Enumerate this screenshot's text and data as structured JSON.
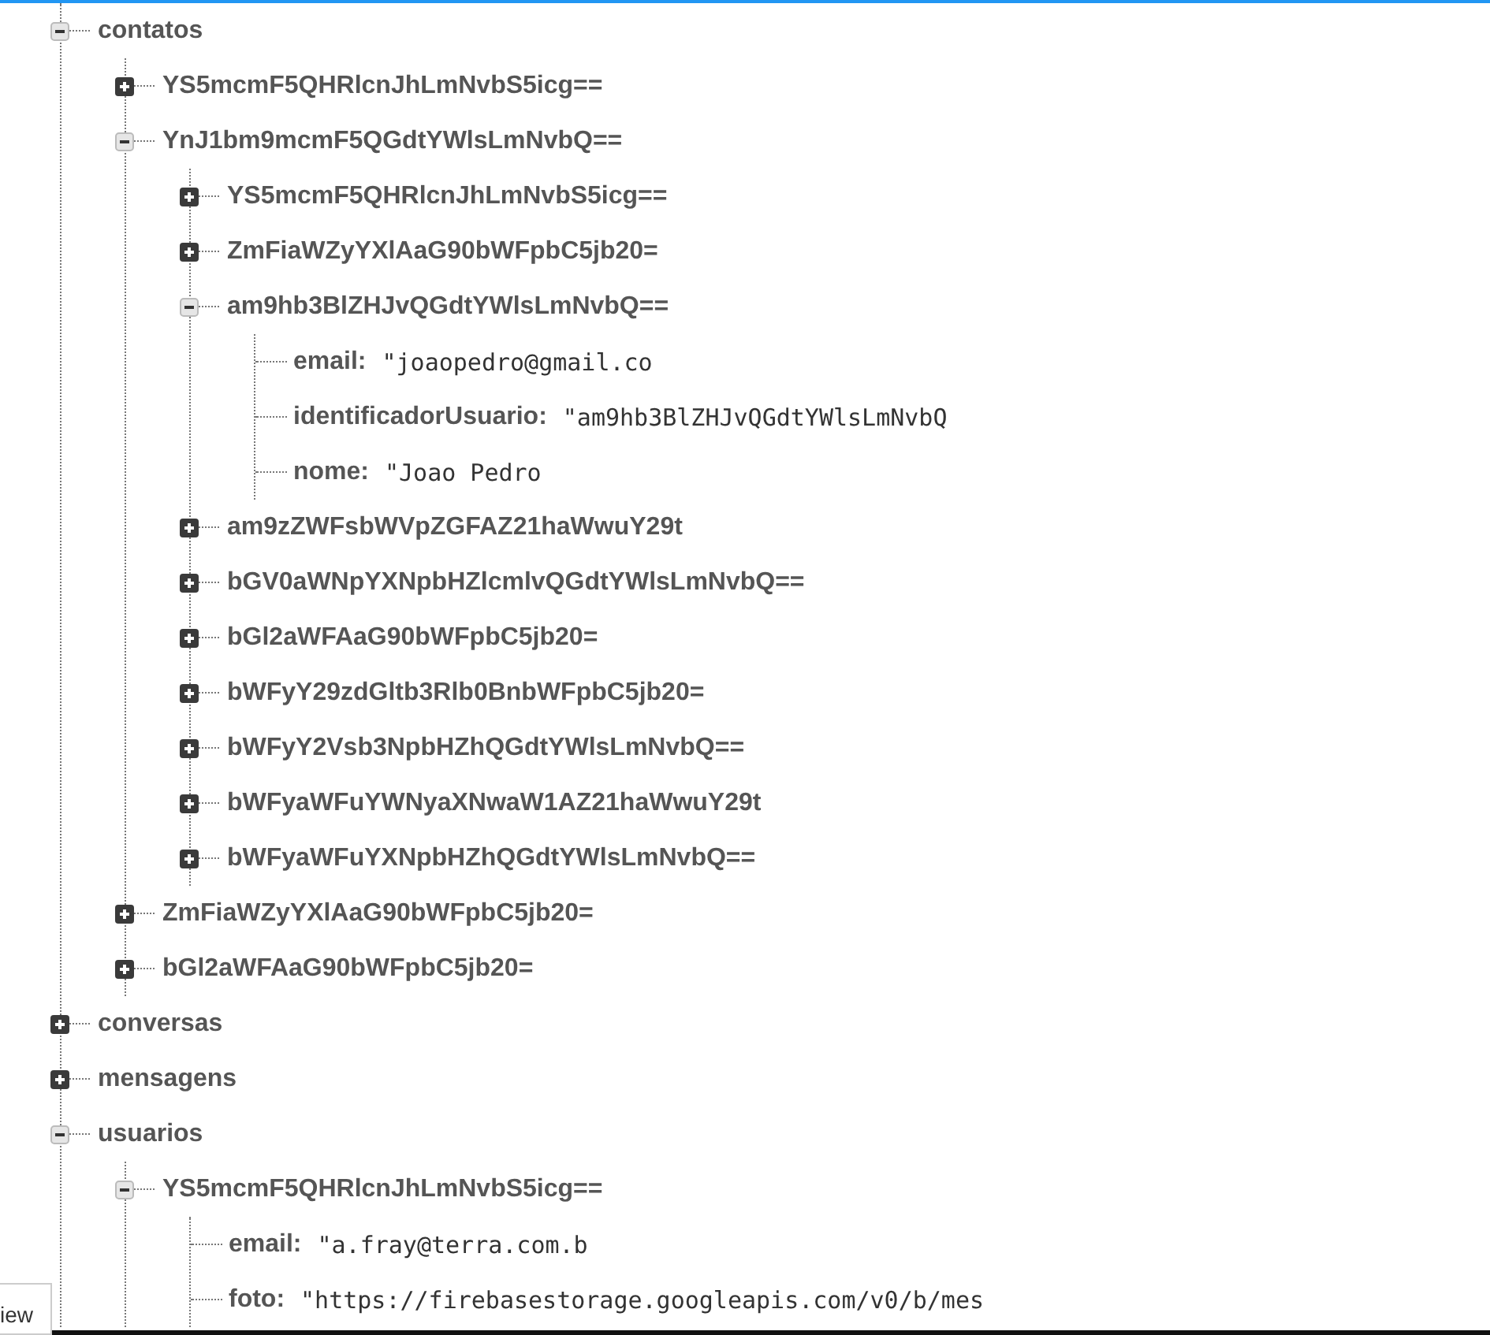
{
  "tree": [
    {
      "kind": "branch",
      "key": "contatos",
      "expanded": true,
      "children": [
        {
          "kind": "branch",
          "key": "YS5mcmF5QHRlcnJhLmNvbS5icg==",
          "expanded": false
        },
        {
          "kind": "branch",
          "key": "YnJ1bm9mcmF5QGdtYWlsLmNvbQ==",
          "expanded": true,
          "children": [
            {
              "kind": "branch",
              "key": "YS5mcmF5QHRlcnJhLmNvbS5icg==",
              "expanded": false
            },
            {
              "kind": "branch",
              "key": "ZmFiaWZyYXlAaG90bWFpbC5jb20=",
              "expanded": false
            },
            {
              "kind": "branch",
              "key": "am9hb3BlZHJvQGdtYWlsLmNvbQ==",
              "expanded": true,
              "children": [
                {
                  "kind": "value",
                  "key": "email:",
                  "value": "\"joaopedro@gmail.co"
                },
                {
                  "kind": "value",
                  "key": "identificadorUsuario:",
                  "value": "\"am9hb3BlZHJvQGdtYWlsLmNvbQ"
                },
                {
                  "kind": "value",
                  "key": "nome:",
                  "value": "\"Joao Pedro"
                }
              ]
            },
            {
              "kind": "branch",
              "key": "am9zZWFsbWVpZGFAZ21haWwuY29t",
              "expanded": false
            },
            {
              "kind": "branch",
              "key": "bGV0aWNpYXNpbHZlcmlvQGdtYWlsLmNvbQ==",
              "expanded": false
            },
            {
              "kind": "branch",
              "key": "bGl2aWFAaG90bWFpbC5jb20=",
              "expanded": false
            },
            {
              "kind": "branch",
              "key": "bWFyY29zdGltb3Rlb0BnbWFpbC5jb20=",
              "expanded": false
            },
            {
              "kind": "branch",
              "key": "bWFyY2Vsb3NpbHZhQGdtYWlsLmNvbQ==",
              "expanded": false
            },
            {
              "kind": "branch",
              "key": "bWFyaWFuYWNyaXNwaW1AZ21haWwuY29t",
              "expanded": false
            },
            {
              "kind": "branch",
              "key": "bWFyaWFuYXNpbHZhQGdtYWlsLmNvbQ==",
              "expanded": false
            }
          ]
        },
        {
          "kind": "branch",
          "key": "ZmFiaWZyYXlAaG90bWFpbC5jb20=",
          "expanded": false
        },
        {
          "kind": "branch",
          "key": "bGl2aWFAaG90bWFpbC5jb20=",
          "expanded": false
        }
      ]
    },
    {
      "kind": "branch",
      "key": "conversas",
      "expanded": false
    },
    {
      "kind": "branch",
      "key": "mensagens",
      "expanded": false
    },
    {
      "kind": "branch",
      "key": "usuarios",
      "expanded": true,
      "children": [
        {
          "kind": "branch",
          "key": "YS5mcmF5QHRlcnJhLmNvbS5icg==",
          "expanded": true,
          "children": [
            {
              "kind": "value",
              "key": "email:",
              "value": "\"a.fray@terra.com.b"
            },
            {
              "kind": "value",
              "key": "foto:",
              "value": "\"https://firebasestorage.googleapis.com/v0/b/mes"
            }
          ]
        }
      ]
    }
  ],
  "corner_tab": "iew"
}
